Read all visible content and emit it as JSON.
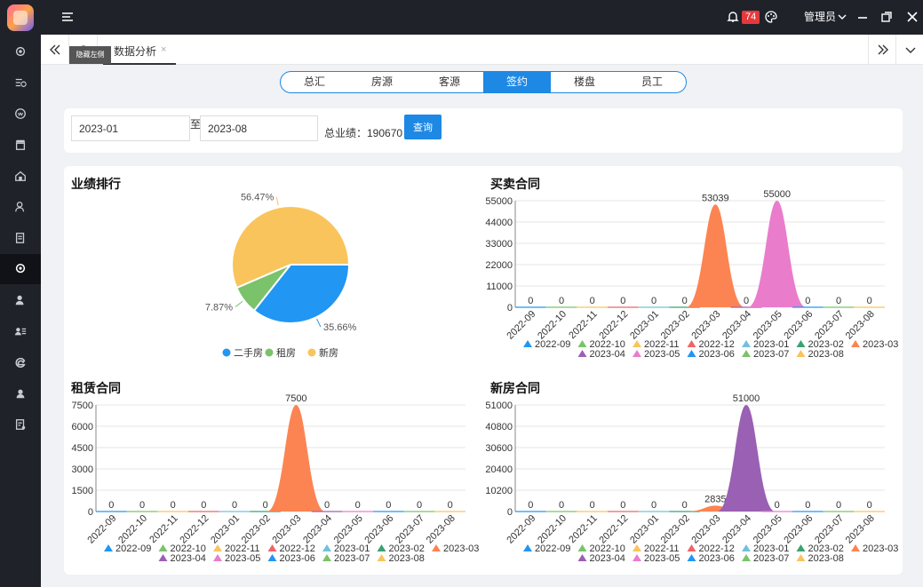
{
  "topbar": {
    "notifications": "74",
    "user": "管理员"
  },
  "tooltip": "隐藏左侧",
  "tab": {
    "label": "数据分析",
    "close": "×"
  },
  "segments": [
    {
      "label": "总汇",
      "active": false
    },
    {
      "label": "房源",
      "active": false
    },
    {
      "label": "客源",
      "active": false
    },
    {
      "label": "签约",
      "active": true
    },
    {
      "label": "楼盘",
      "active": false
    },
    {
      "label": "员工",
      "active": false
    }
  ],
  "filter": {
    "start": "2023-01",
    "to": "至",
    "end": "2023-08",
    "total_label": "总业绩：190670",
    "query": "查询"
  },
  "colors": {
    "months": [
      "#2196f3",
      "#7ac36a",
      "#f9c45c",
      "#ee6666",
      "#73c0de",
      "#3ba272",
      "#fc8452",
      "#9a60b4",
      "#ea7ccc",
      "#2196f3",
      "#7ac36a",
      "#f9c45c"
    ],
    "grid": "#e6e6e6",
    "axis": "#555"
  },
  "chart_data": [
    {
      "type": "pie",
      "title": "业绩排行",
      "categories": [
        "二手房",
        "租房",
        "新房"
      ],
      "values": [
        35.66,
        7.87,
        56.47
      ],
      "labels": [
        "35.66%",
        "7.87%",
        "56.47%"
      ],
      "colors": [
        "#2196f3",
        "#7ac36a",
        "#f9c45c"
      ],
      "legend": "bottom"
    },
    {
      "type": "area",
      "title": "买卖合同",
      "categories": [
        "2022-09",
        "2022-10",
        "2022-11",
        "2022-12",
        "2023-01",
        "2023-02",
        "2023-03",
        "2023-04",
        "2023-05",
        "2023-06",
        "2023-07",
        "2023-08"
      ],
      "values": [
        0,
        0,
        0,
        0,
        0,
        0,
        53039,
        0,
        55000,
        0,
        0,
        0
      ],
      "yticks": [
        "0",
        "11000",
        "22000",
        "33000",
        "44000",
        "55000"
      ],
      "ylim": [
        0,
        55000
      ],
      "legend": "bottom"
    },
    {
      "type": "area",
      "title": "租赁合同",
      "categories": [
        "2022-09",
        "2022-10",
        "2022-11",
        "2022-12",
        "2023-01",
        "2023-02",
        "2023-03",
        "2023-04",
        "2023-05",
        "2023-06",
        "2023-07",
        "2023-08"
      ],
      "values": [
        0,
        0,
        0,
        0,
        0,
        0,
        7500,
        0,
        0,
        0,
        0,
        0
      ],
      "yticks": [
        "0",
        "1500",
        "3000",
        "4500",
        "6000",
        "7500"
      ],
      "ylim": [
        0,
        7500
      ],
      "legend": "bottom"
    },
    {
      "type": "area",
      "title": "新房合同",
      "categories": [
        "2022-09",
        "2022-10",
        "2022-11",
        "2022-12",
        "2023-01",
        "2023-02",
        "2023-03",
        "2023-04",
        "2023-05",
        "2023-06",
        "2023-07",
        "2023-08"
      ],
      "values": [
        0,
        0,
        0,
        0,
        0,
        0,
        2835,
        51000,
        0,
        0,
        0,
        0
      ],
      "yticks": [
        "0",
        "10200",
        "20400",
        "30600",
        "40800",
        "51000"
      ],
      "ylim": [
        0,
        51000
      ],
      "legend": "bottom"
    }
  ]
}
